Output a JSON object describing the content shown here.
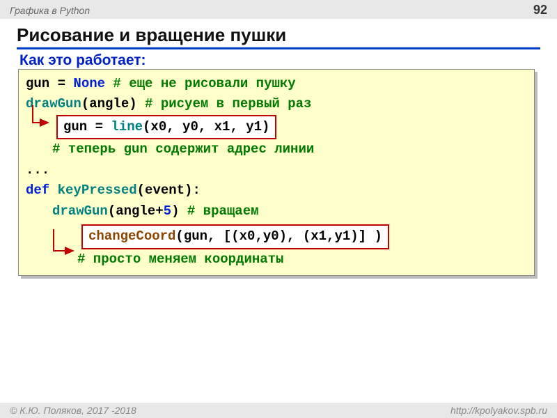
{
  "header": {
    "left": "Графика в Python",
    "page": "92"
  },
  "title": "Рисование и вращение пушки",
  "subtitle": "Как это работает:",
  "code": {
    "l1_a": "gun = ",
    "l1_b": "None",
    "l1_c": " # еще не рисовали пушку",
    "l2_a": "drawGun",
    "l2_b": "(angle)  ",
    "l2_c": "# рисуем в первый раз",
    "box1_a": "gun = ",
    "box1_b": "line",
    "box1_c": "(x0, y0, x1, y1)",
    "l4": "# теперь gun содержит адрес линии",
    "l5": "...",
    "l6_a": "def ",
    "l6_b": "keyPressed",
    "l6_c": "(event):",
    "l7_a": "drawGun",
    "l7_b": "(angle+",
    "l7_c": "5",
    "l7_d": ")  ",
    "l7_e": "# вращаем",
    "box2_a": "changeCoord",
    "box2_b": "(gun, [(x0,y0), (x1,y1)] )",
    "l9": "# просто меняем координаты"
  },
  "footer": {
    "left": "© К.Ю. Поляков, 2017 -2018",
    "right": "http://kpolyakov.spb.ru"
  }
}
